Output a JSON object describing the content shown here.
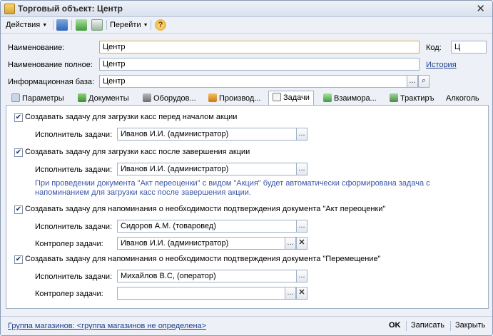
{
  "window": {
    "title": "Торговый объект: Центр"
  },
  "toolbar": {
    "actions": "Действия",
    "goto": "Перейти"
  },
  "header": {
    "name_label": "Наименование:",
    "name_value": "Центр",
    "code_label": "Код:",
    "code_value": "Ц",
    "fullname_label": "Наименование полное:",
    "fullname_value": "Центр",
    "history_link": "История",
    "infobase_label": "Информационная база:",
    "infobase_value": "Центр"
  },
  "tabs": [
    "Параметры",
    "Документы",
    "Оборудов...",
    "Производ...",
    "Задачи",
    "Взаимора...",
    "Трактиръ",
    "Алкоголь"
  ],
  "tasks": {
    "task1_label": "Создавать задачу для загрузки касс перед началом акции",
    "task1_executor_label": "Исполнитель задачи:",
    "task1_executor_value": "Иванов И.И. (администратор)",
    "task2_label": "Создавать задачу для загрузки касс после завершения акции",
    "task2_executor_label": "Исполнитель задачи:",
    "task2_executor_value": "Иванов И.И. (администратор)",
    "task2_note_line1": "При проведении документа \"Акт переоценки\" с видом \"Акция\" будет автоматически сформирована задача с",
    "task2_note_line2": "напоминанием для загрузки касс после завершения акции.",
    "task3_label": "Создавать задачу для напоминания о необходимости подтверждения документа \"Акт переоценки\"",
    "task3_executor_label": "Исполнитель задачи:",
    "task3_executor_value": "Сидоров А.М. (товаровед)",
    "task3_controller_label": "Контролер задачи:",
    "task3_controller_value": "Иванов И.И. (администратор)",
    "task4_label": "Создавать задачу для напоминания о необходимости подтверждения документа \"Перемещение\"",
    "task4_executor_label": "Исполнитель задачи:",
    "task4_executor_value": "Михайлов В.С, (оператор)",
    "task4_controller_label": "Контролер задачи:",
    "task4_controller_value": ""
  },
  "footer": {
    "group_link": "Группа магазинов: <группа магазинов не определена>",
    "ok": "OK",
    "save": "Записать",
    "close": "Закрыть"
  },
  "glyphs": {
    "ellipsis": "...",
    "clear": "✕",
    "check": "✔",
    "search": "⌕",
    "help": "?"
  },
  "icons": [
    "document-icon",
    "refresh-icon",
    "copy-icon",
    "help-icon",
    "search-icon",
    "clear-icon"
  ]
}
